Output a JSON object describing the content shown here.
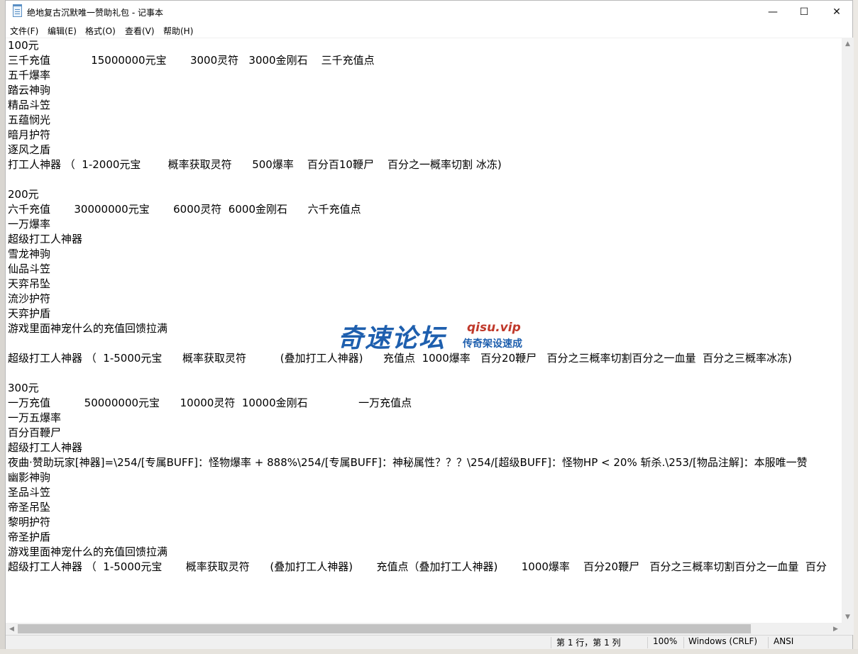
{
  "window": {
    "title": "绝地复古沉默唯一赞助礼包 - 记事本",
    "minimize_glyph": "—",
    "maximize_glyph": "☐",
    "close_glyph": "✕",
    "app_icon": "notepad-icon"
  },
  "menu": {
    "items": [
      {
        "label": "文件(F)"
      },
      {
        "label": "编辑(E)"
      },
      {
        "label": "格式(O)"
      },
      {
        "label": "查看(V)"
      },
      {
        "label": "帮助(H)"
      }
    ]
  },
  "document": {
    "lines": [
      "100元",
      "三千充值            15000000元宝       3000灵符   3000金刚石    三千充值点",
      "五千爆率",
      "踏云神驹",
      "精品斗笠",
      "五蕴悯光",
      "暗月护符",
      "逐风之盾",
      "打工人神器 （  1-2000元宝        概率获取灵符      500爆率    百分百10鞭尸    百分之一概率切割 冰冻)",
      "",
      "200元",
      "六千充值       30000000元宝       6000灵符  6000金刚石      六千充值点",
      "一万爆率",
      "超级打工人神器",
      "雪龙神驹",
      "仙品斗笠",
      "天弈吊坠",
      "流沙护符",
      "天弈护盾",
      "游戏里面神宠什么的充值回馈拉满",
      "",
      "超级打工人神器 （  1-5000元宝      概率获取灵符          (叠加打工人神器)      充值点  1000爆率   百分20鞭尸   百分之三概率切割百分之一血量  百分之三概率冰冻)",
      "",
      "300元",
      "一万充值          50000000元宝      10000灵符  10000金刚石               一万充值点",
      "一万五爆率",
      "百分百鞭尸",
      "超级打工人神器",
      "夜曲·赞助玩家[神器]=\\254/[专属BUFF]：怪物爆率 + 888%\\254/[专属BUFF]：神秘属性？？？\\254/[超级BUFF]：怪物HP < 20% 斩杀.\\253/[物品注解]：本服唯一赞",
      "幽影神驹",
      "圣品斗笠",
      "帝圣吊坠",
      "黎明护符",
      "帝圣护盾",
      "游戏里面神宠什么的充值回馈拉满",
      "超级打工人神器 （  1-5000元宝       概率获取灵符      (叠加打工人神器)       充值点（叠加打工人神器)       1000爆率    百分20鞭尸   百分之三概率切割百分之一血量  百分"
    ]
  },
  "watermark": {
    "main": "奇速论坛",
    "url": "qisu.vip",
    "tagline": "传奇架设速成"
  },
  "status": {
    "position": "第 1 行，第 1 列",
    "zoom": "100%",
    "line_ending": "Windows (CRLF)",
    "encoding": "ANSI"
  },
  "scrollbars": {
    "up_glyph": "▲",
    "down_glyph": "▼",
    "left_glyph": "◀",
    "right_glyph": "▶"
  }
}
